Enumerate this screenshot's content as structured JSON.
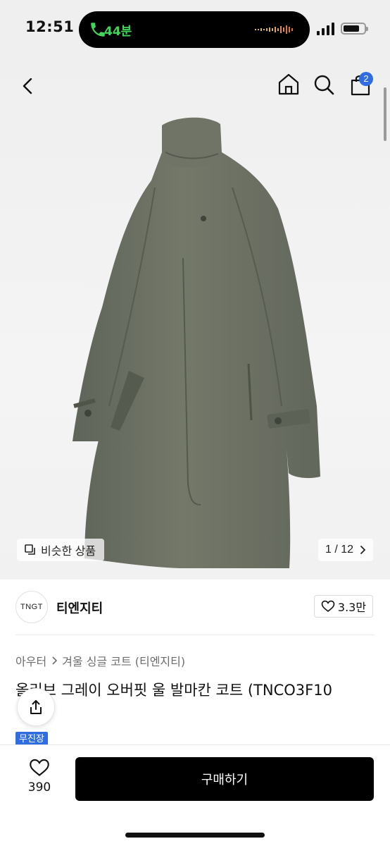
{
  "status_bar": {
    "time": "12:51",
    "call_duration": "44분",
    "battery_level": 0.8
  },
  "nav": {
    "cart_count": "2"
  },
  "gallery": {
    "similar_label": "비슷한 상품",
    "page_indicator": "1 / 12"
  },
  "shop": {
    "logo_text": "TNGT",
    "name": "티엔지티",
    "likes": "3.3만"
  },
  "product": {
    "breadcrumb": [
      "아우터",
      "겨울 싱글 코트 (티엔지티)"
    ],
    "title": "올리브 그레이 오버핏 울 발마칸 코트 (TNCO3F10",
    "badge": "무진장"
  },
  "bottom_bar": {
    "wish_count": "390",
    "buy_label": "구매하기"
  },
  "colors": {
    "accent": "#2f6de1",
    "coat": "#6b7065",
    "call_green": "#42d55b"
  },
  "icons": {
    "back": "chevron-left-icon",
    "home": "home-icon",
    "search": "search-icon",
    "cart": "shopping-bag-icon",
    "similar": "copy-icon",
    "page_next": "chevron-right-icon",
    "like": "heart-icon",
    "share": "share-icon",
    "wish": "heart-icon"
  }
}
